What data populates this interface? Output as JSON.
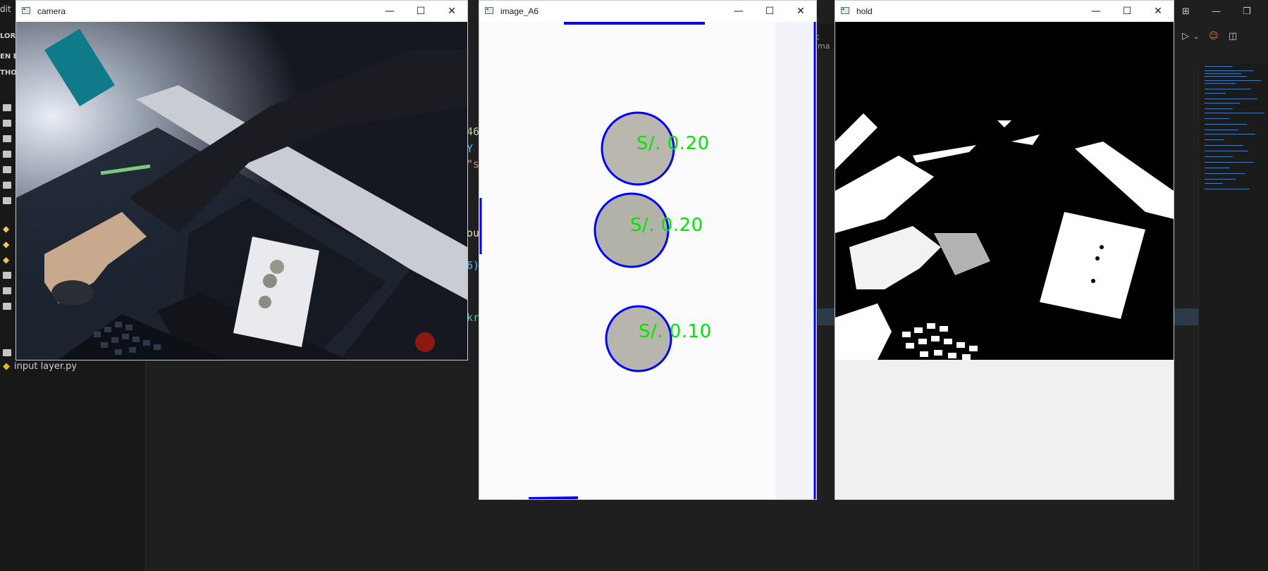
{
  "vscode": {
    "menu_fragment": "dit",
    "explorer_fragment": "LORE",
    "open_editors_fragment": "EN EI",
    "python_fragment": "THON",
    "file_label": "input layer.py",
    "tab_fragment": "c ima",
    "code_fragments": [
      "46",
      "Y",
      "\"s",
      "ou",
      "6)",
      "kr"
    ]
  },
  "windows": {
    "camera": {
      "title": "camera"
    },
    "image": {
      "title": "image_A6",
      "coins": [
        {
          "label": "S/. 0.20"
        },
        {
          "label": "S/. 0.20"
        },
        {
          "label": "S/. 0.10"
        }
      ]
    },
    "hold": {
      "title": "hold"
    }
  },
  "colors": {
    "contour": "#0000ff",
    "coin_label": "#00e600",
    "vscode_bg": "#1f1f1f"
  },
  "icons": {
    "minimize": "minimize-icon",
    "maximize": "maximize-icon",
    "close": "close-icon"
  }
}
